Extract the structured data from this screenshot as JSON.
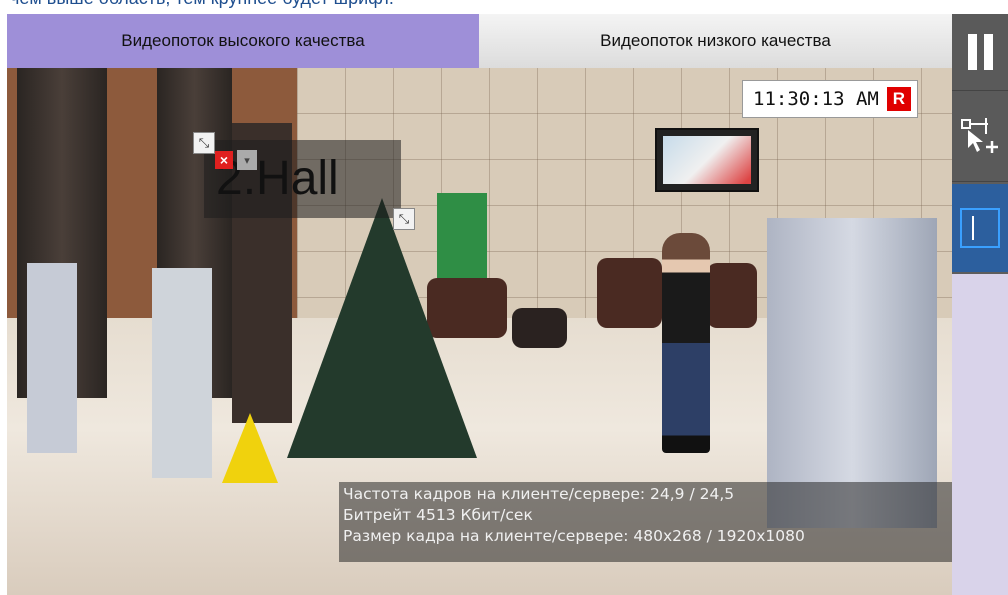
{
  "caption": "чем выше область, тем крупнее будет шрифт.",
  "tabs": [
    {
      "label": "Видеопоток высокого качества",
      "active": true
    },
    {
      "label": "Видеопоток низкого качества",
      "active": false
    }
  ],
  "overlay": {
    "time": "11:30:13 AM",
    "record_badge": "R",
    "zone_title": "2.Hall",
    "zone_close": "×",
    "zone_menu": "▾"
  },
  "stats": {
    "fps": "Частота кадров на клиенте/сервере: 24,9 / 24,5",
    "bitrate": "Битрейт 4513 Кбит/сек",
    "frame_size": "Размер кадра на клиенте/сервере: 480x268 / 1920x1080"
  },
  "side_tools": {
    "pause_icon": "pause-icon",
    "add_zone_icon": "add-zone-icon",
    "select_icon": "select-region-icon"
  },
  "colors": {
    "active_tab": "#9e8fd8",
    "record_badge": "#e00000",
    "select_tool": "#2c5f9e"
  }
}
